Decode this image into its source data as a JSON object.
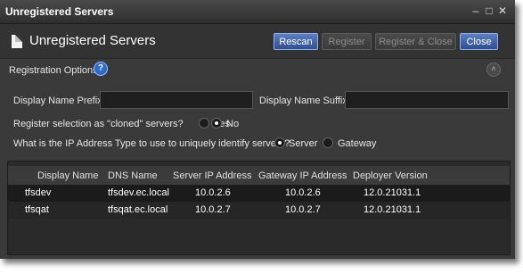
{
  "window": {
    "title": "Unregistered Servers",
    "controls": [
      "–",
      "□",
      "✕"
    ]
  },
  "header": {
    "title": "Unregistered Servers",
    "icon": "document-icon"
  },
  "toolbar": {
    "rescan": "Rescan",
    "register": "Register",
    "register_close": "Register & Close",
    "close": "Close"
  },
  "options": {
    "section_title": "Registration Options",
    "help_glyph": "?",
    "collapse_glyph": "˄",
    "prefix_label": "Display Name Prefix",
    "prefix_value": "",
    "suffix_label": "Display Name Suffix",
    "suffix_value": "",
    "cloned_question": "Register selection as \"cloned\" servers?",
    "cloned_yes": "Yes",
    "cloned_no": "No",
    "cloned_selected": "No",
    "ip_question": "What is the IP Address Type to use to uniquely identify servers?",
    "ip_server": "Server",
    "ip_gateway": "Gateway",
    "ip_selected": "Server"
  },
  "table": {
    "columns": [
      "Display Name",
      "DNS Name",
      "Server IP Address",
      "Gateway IP Address",
      "Deployer Version"
    ],
    "rows": [
      [
        "tfsdev",
        "tfsdev.ec.local",
        "10.0.2.6",
        "10.0.2.6",
        "12.0.21031.1"
      ],
      [
        "tfsqat",
        "tfsqat.ec.local",
        "10.0.2.7",
        "10.0.2.7",
        "12.0.21031.1"
      ]
    ]
  },
  "colors": {
    "accent": "#2e4f92",
    "background": "#3a3a3a",
    "selected_row": "#1b1b1b"
  }
}
